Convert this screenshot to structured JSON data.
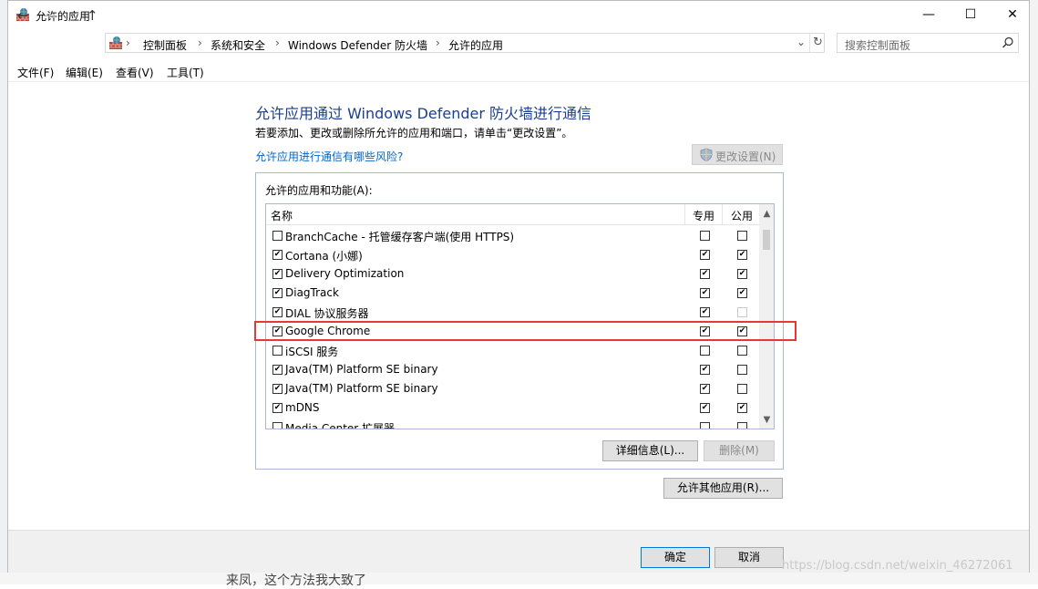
{
  "window": {
    "title": "允许的应用",
    "controls": [
      "—",
      "☐",
      "✕"
    ]
  },
  "nav": {
    "back": "←",
    "forward": "→",
    "recent": "⌄",
    "up": "↑",
    "breadcrumbs": [
      "控制面板",
      "系统和安全",
      "Windows Defender 防火墙",
      "允许的应用"
    ],
    "refresh": "↻",
    "search_placeholder": "搜索控制面板"
  },
  "menu": [
    "文件(F)",
    "编辑(E)",
    "查看(V)",
    "工具(T)"
  ],
  "main": {
    "heading": "允许应用通过 Windows Defender 防火墙进行通信",
    "description": "若要添加、更改或删除所允许的应用和端口，请单击“更改设置”。",
    "risk_link": "允许应用进行通信有哪些风险?",
    "change_settings": "更改设置(N)",
    "group_label": "允许的应用和功能(A):",
    "columns": {
      "name": "名称",
      "private": "专用",
      "public": "公用"
    },
    "rows": [
      {
        "name": "BranchCache - 托管缓存客户端(使用 HTTPS)",
        "enabled": false,
        "private": false,
        "public": false
      },
      {
        "name": "Cortana (小娜)",
        "enabled": true,
        "private": true,
        "public": true
      },
      {
        "name": "Delivery Optimization",
        "enabled": true,
        "private": true,
        "public": true
      },
      {
        "name": "DiagTrack",
        "enabled": true,
        "private": true,
        "public": true
      },
      {
        "name": "DIAL 协议服务器",
        "enabled": true,
        "private": true,
        "public": false
      },
      {
        "name": "Google Chrome",
        "enabled": true,
        "private": true,
        "public": true
      },
      {
        "name": "iSCSI 服务",
        "enabled": false,
        "private": false,
        "public": false
      },
      {
        "name": "Java(TM) Platform SE binary",
        "enabled": true,
        "private": true,
        "public": false
      },
      {
        "name": "Java(TM) Platform SE binary",
        "enabled": true,
        "private": true,
        "public": false
      },
      {
        "name": "mDNS",
        "enabled": true,
        "private": true,
        "public": true
      },
      {
        "name": "Media Center 扩展器",
        "enabled": false,
        "private": false,
        "public": false
      }
    ],
    "details_button": "详细信息(L)...",
    "remove_button": "删除(M)",
    "allow_other_button": "允许其他应用(R)..."
  },
  "footer": {
    "ok": "确定",
    "cancel": "取消"
  },
  "background": {
    "text": "来凤，这个方法我大致了",
    "watermark": "https://blog.csdn.net/weixin_46272061"
  },
  "colors": {
    "heading": "#1a3f8f",
    "link": "#0066cc",
    "highlight": "#e53935"
  }
}
